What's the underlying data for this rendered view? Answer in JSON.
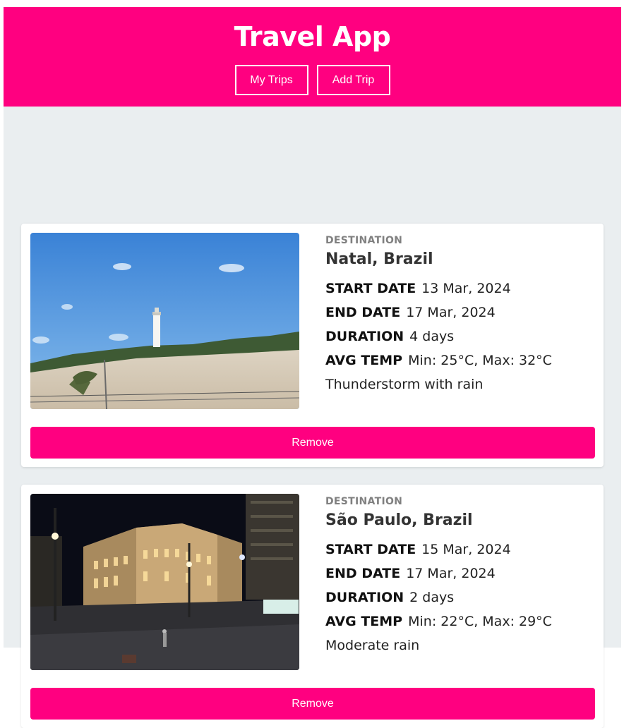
{
  "app": {
    "title": "Travel App",
    "nav": {
      "my_trips": "My Trips",
      "add_trip": "Add Trip"
    },
    "accent_color": "#ff0080",
    "background_color": "#eaeef0"
  },
  "labels": {
    "destination": "DESTINATION",
    "start_date": "START DATE",
    "end_date": "END DATE",
    "duration": "DURATION",
    "avg_temp": "AVG TEMP",
    "remove": "Remove"
  },
  "trips": [
    {
      "destination": "Natal, Brazil",
      "start_date": "13 Mar, 2024",
      "end_date": "17 Mar, 2024",
      "duration": "4 days",
      "avg_temp": "Min: 25°C, Max: 32°C",
      "weather": "Thunderstorm with rain",
      "photo": "lighthouse-on-sand-dunes"
    },
    {
      "destination": "São Paulo, Brazil",
      "start_date": "15 Mar, 2024",
      "end_date": "17 Mar, 2024",
      "duration": "2 days",
      "avg_temp": "Min: 22°C, Max: 29°C",
      "weather": "Moderate rain",
      "photo": "city-square-at-night"
    }
  ]
}
